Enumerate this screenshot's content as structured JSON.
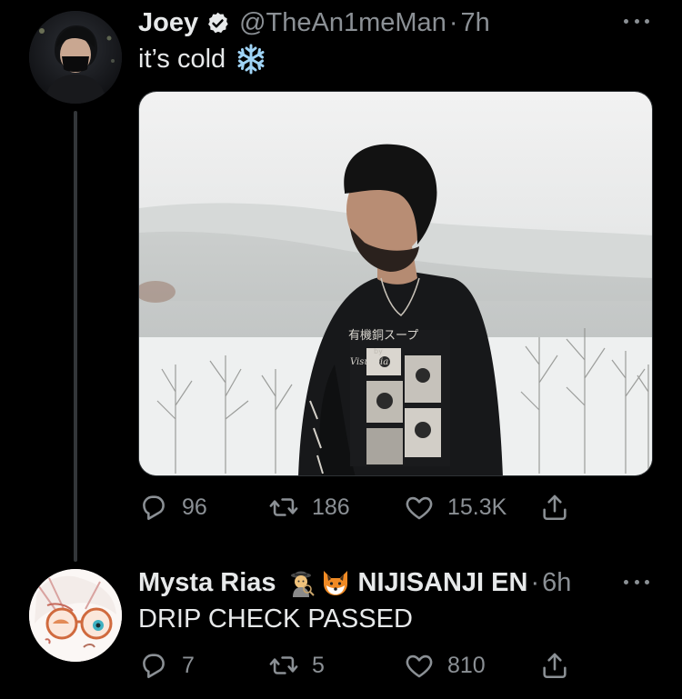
{
  "tweet": {
    "author": {
      "display_name": "Joey",
      "handle": "@TheAn1meMan",
      "time": "7h",
      "verified": true
    },
    "text": "it’s cold",
    "emoji": "snowflake-icon",
    "media": {
      "alt_subject": "man in black graphic long-sleeve shirt on snowy hilltop",
      "shirt_text": [
        "有機銅スープ",
        "by",
        "Visurbia"
      ]
    },
    "stats": {
      "replies": "96",
      "retweets": "186",
      "likes": "15.3K"
    }
  },
  "reply": {
    "author": {
      "display_name": "Mysta Rias",
      "affiliation": "NIJISANJI EN",
      "time": "6h"
    },
    "emojis": [
      "detective-icon",
      "fox-icon"
    ],
    "text": "DRIP CHECK PASSED",
    "stats": {
      "replies": "7",
      "retweets": "5",
      "likes": "810"
    }
  },
  "colors": {
    "background": "#000000",
    "text_primary": "#e7e9ea",
    "text_secondary": "#8b9095",
    "thread_line": "#333639"
  },
  "sep": "·"
}
